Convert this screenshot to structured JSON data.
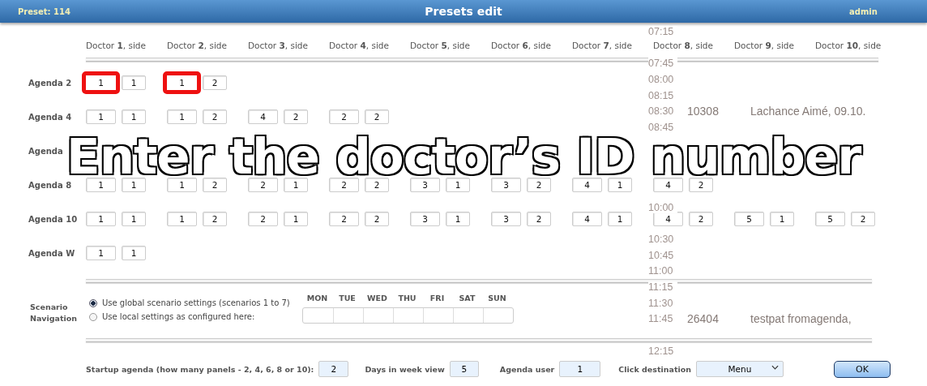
{
  "window": {
    "preset": "Preset: 114",
    "title": "Presets edit",
    "user": "admin"
  },
  "backdrop": [
    {
      "time": "07:15"
    },
    {
      "time": "07:45"
    },
    {
      "time": "08:00"
    },
    {
      "time": "08:15"
    },
    {
      "time": "08:30",
      "id": "10308",
      "name": "Lachance Aimé, 09.10."
    },
    {
      "time": "08:45"
    },
    {
      "time": "10:00"
    },
    {
      "time": "10:30"
    },
    {
      "time": "10:45"
    },
    {
      "time": "11:00"
    },
    {
      "time": "11:15"
    },
    {
      "time": "11:30"
    },
    {
      "time": "11:45",
      "id": "26404",
      "name": "testpat fromagenda,"
    },
    {
      "time": "12:15"
    }
  ],
  "doctors": [
    "Doctor **1**, side",
    "Doctor **2**, side",
    "Doctor **3**, side",
    "Doctor **4**, side",
    "Doctor **5**, side",
    "Doctor **6**, side",
    "Doctor **7**, side",
    "Doctor **8**, side",
    "Doctor **9**, side",
    "Doctor **10**, side"
  ],
  "agendas": [
    {
      "label": "Agenda 2",
      "cells": [
        [
          {
            "value": "1",
            "highlighted": true
          },
          {
            "value": "1",
            "highlighted": false
          }
        ],
        [
          {
            "value": "1",
            "highlighted": true
          },
          {
            "value": "2",
            "highlighted": false
          }
        ]
      ]
    },
    {
      "label": "Agenda 4",
      "cells": [
        [
          {
            "value": "1",
            "highlighted": false
          },
          {
            "value": "1",
            "highlighted": false
          }
        ],
        [
          {
            "value": "1",
            "highlighted": false
          },
          {
            "value": "2",
            "highlighted": false
          }
        ],
        [
          {
            "value": "4",
            "highlighted": false
          },
          {
            "value": "2",
            "highlighted": false
          }
        ],
        [
          {
            "value": "2",
            "highlighted": false
          },
          {
            "value": "2",
            "highlighted": false
          }
        ]
      ]
    },
    {
      "label": "Agenda"
    },
    {
      "label": "Agenda 8",
      "cells": [
        [
          {
            "value": "1",
            "highlighted": false
          },
          {
            "value": "1",
            "highlighted": false
          }
        ],
        [
          {
            "value": "1",
            "highlighted": false
          },
          {
            "value": "2",
            "highlighted": false
          }
        ],
        [
          {
            "value": "2",
            "highlighted": false
          },
          {
            "value": "1",
            "highlighted": false
          }
        ],
        [
          {
            "value": "2",
            "highlighted": false
          },
          {
            "value": "2",
            "highlighted": false
          }
        ],
        [
          {
            "value": "3",
            "highlighted": false
          },
          {
            "value": "1",
            "highlighted": false
          }
        ],
        [
          {
            "value": "3",
            "highlighted": false
          },
          {
            "value": "2",
            "highlighted": false
          }
        ],
        [
          {
            "value": "4",
            "highlighted": false
          },
          {
            "value": "1",
            "highlighted": false
          }
        ],
        [
          {
            "value": "4",
            "highlighted": false
          },
          {
            "value": "2",
            "highlighted": false
          }
        ]
      ]
    },
    {
      "label": "Agenda 10",
      "cells": [
        [
          {
            "value": "1",
            "highlighted": false
          },
          {
            "value": "1",
            "highlighted": false
          }
        ],
        [
          {
            "value": "1",
            "highlighted": false
          },
          {
            "value": "2",
            "highlighted": false
          }
        ],
        [
          {
            "value": "2",
            "highlighted": false
          },
          {
            "value": "1",
            "highlighted": false
          }
        ],
        [
          {
            "value": "2",
            "highlighted": false
          },
          {
            "value": "2",
            "highlighted": false
          }
        ],
        [
          {
            "value": "3",
            "highlighted": false
          },
          {
            "value": "1",
            "highlighted": false
          }
        ],
        [
          {
            "value": "3",
            "highlighted": false
          },
          {
            "value": "2",
            "highlighted": false
          }
        ],
        [
          {
            "value": "4",
            "highlighted": false
          },
          {
            "value": "1",
            "highlighted": false
          }
        ],
        [
          {
            "value": "4",
            "highlighted": false
          },
          {
            "value": "2",
            "highlighted": false
          }
        ],
        [
          {
            "value": "5",
            "highlighted": false
          },
          {
            "value": "1",
            "highlighted": false
          }
        ],
        [
          {
            "value": "5",
            "highlighted": false
          },
          {
            "value": "2",
            "highlighted": false
          }
        ]
      ]
    },
    {
      "label": "Agenda W",
      "cells": [
        [
          {
            "value": "1",
            "highlighted": false
          },
          {
            "value": "1",
            "highlighted": false
          }
        ]
      ]
    }
  ],
  "scenario": {
    "label": "Scenario Navigation",
    "options": [
      {
        "label": "Use global scenario settings (scenarios 1 to 7)",
        "selected": true
      },
      {
        "label": "Use local settings as configured here:",
        "selected": false
      }
    ],
    "days": [
      "MON",
      "TUE",
      "WED",
      "THU",
      "FRI",
      "SAT",
      "SUN"
    ]
  },
  "settings": [
    {
      "kind": "input",
      "label": "Startup agenda (how many panels - 2, 4, 6, 8 or 10):",
      "value": "2"
    },
    {
      "kind": "input",
      "label": "Days in week view",
      "value": "5"
    },
    {
      "kind": "input",
      "label": "Agenda user",
      "value": "1"
    },
    {
      "kind": "select",
      "label": "Click destination",
      "value": "Menu"
    }
  ],
  "ok_button": "OK",
  "caption": "Enter the doctor’s ID number"
}
